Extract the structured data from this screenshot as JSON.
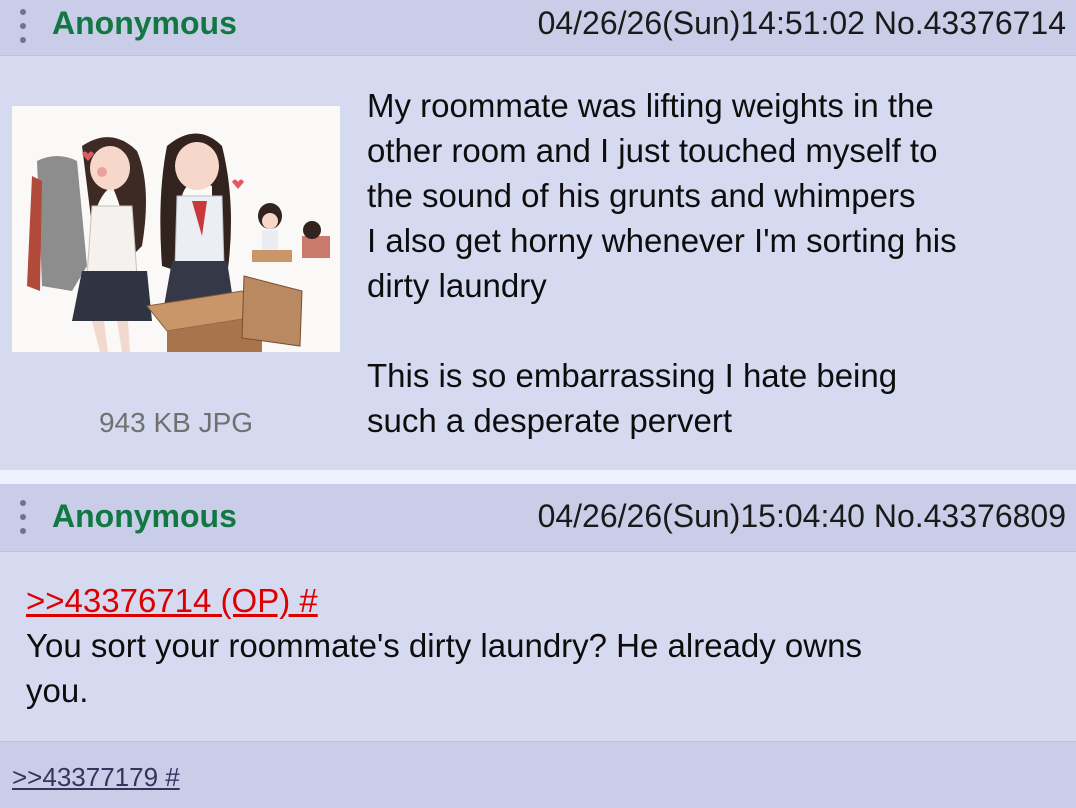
{
  "posts": [
    {
      "name": "Anonymous",
      "datetime": "04/26/26(Sun)14:51:02",
      "number": "No.43376714",
      "file_info": "943 KB JPG",
      "lines": [
        "My roommate was lifting weights in the",
        "other room and I just touched myself to",
        "the sound of his grunts and whimpers",
        "I also get horny whenever I'm sorting his",
        "dirty laundry",
        "This is so embarrassing I hate being",
        "such a desperate pervert"
      ]
    },
    {
      "name": "Anonymous",
      "datetime": "04/26/26(Sun)15:04:40",
      "number": "No.43376809",
      "quote_link": ">>43376714 (OP) #",
      "lines": [
        "You sort your roommate's dirty laundry? He already owns",
        "you."
      ],
      "backlink": ">>43377179 #"
    }
  ],
  "colors": {
    "name": "#117743",
    "post_bg": "#d6daf0",
    "header_bg": "#c9cde8",
    "page_bg": "#eef2ff",
    "quote_link": "#dd0000",
    "backlink": "#34345c"
  },
  "icons": {
    "menu": "vertical-ellipsis-icon"
  }
}
